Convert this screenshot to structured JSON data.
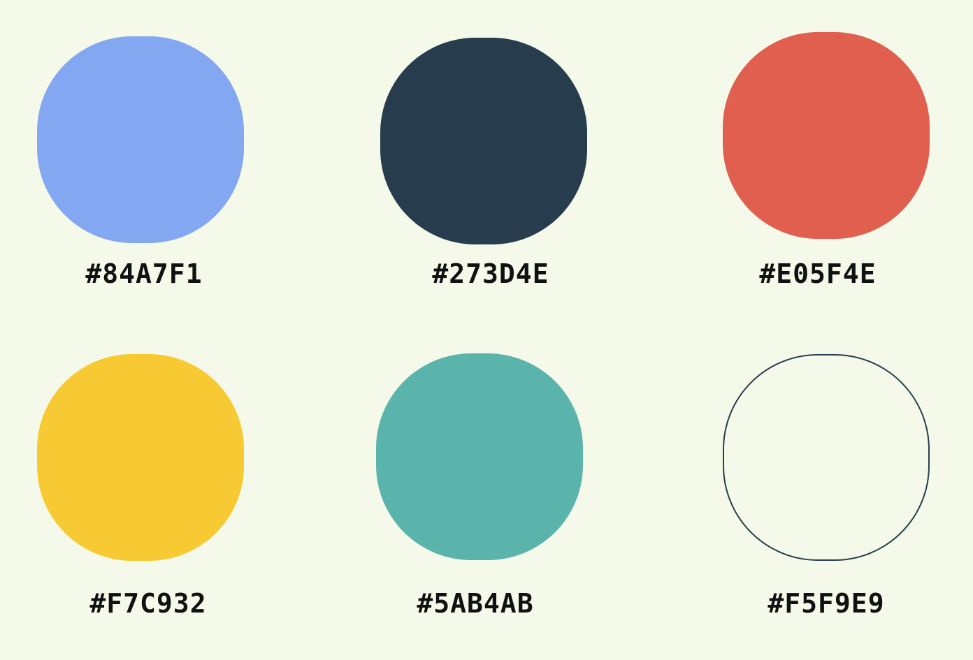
{
  "background_color": "#F5F9E9",
  "outline_color": "#273D4E",
  "swatches": [
    {
      "hex": "#84A7F1",
      "label": "#84A7F1"
    },
    {
      "hex": "#273D4E",
      "label": "#273D4E"
    },
    {
      "hex": "#E05F4E",
      "label": "#E05F4E"
    },
    {
      "hex": "#F7C932",
      "label": "#F7C932"
    },
    {
      "hex": "#5AB4AB",
      "label": "#5AB4AB"
    },
    {
      "hex": "#F5F9E9",
      "label": "#F5F9E9",
      "outlined": true
    }
  ]
}
